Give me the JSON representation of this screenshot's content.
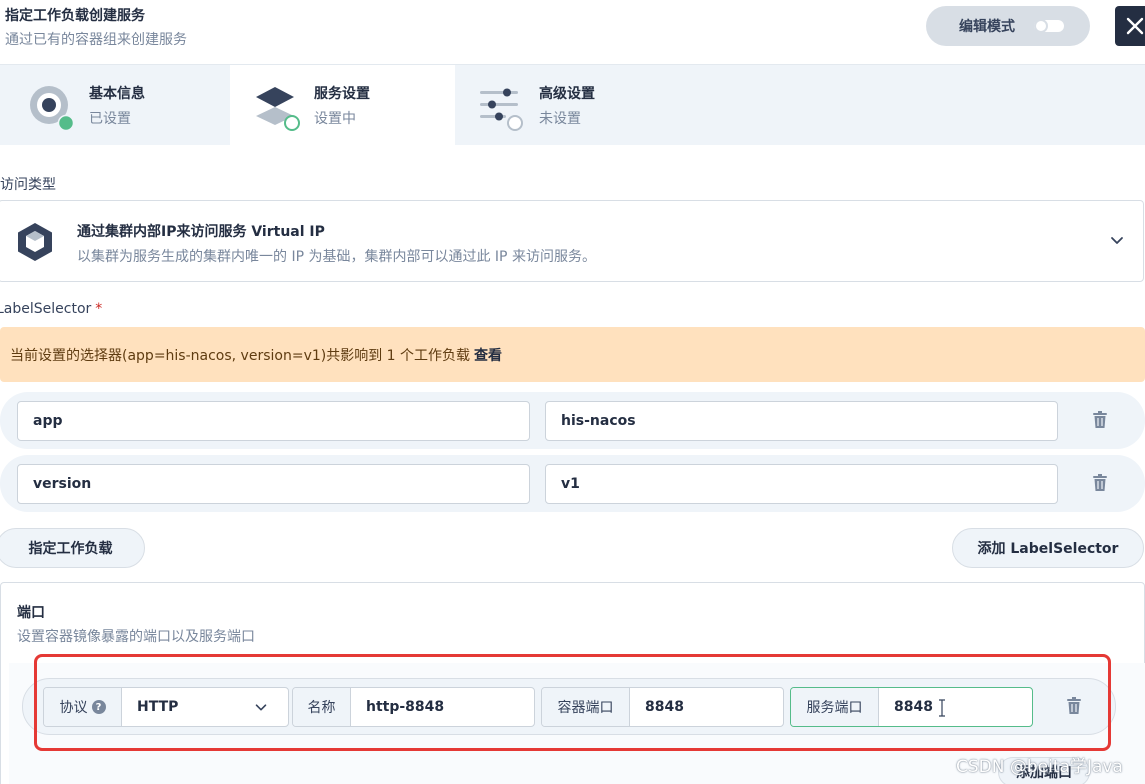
{
  "header": {
    "title": "指定工作负载创建服务",
    "subtitle": "通过已有的容器组来创建服务",
    "edit_mode_label": "编辑模式",
    "close_icon": "close-icon"
  },
  "steps": [
    {
      "label": "基本信息",
      "status": "已设置",
      "icon": "basic-info-icon",
      "state": "done"
    },
    {
      "label": "服务设置",
      "status": "设置中",
      "icon": "service-settings-icon",
      "state": "active"
    },
    {
      "label": "高级设置",
      "status": "未设置",
      "icon": "advanced-settings-icon",
      "state": "pending"
    }
  ],
  "access_type": {
    "section_label": "访问类型",
    "title": "通过集群内部IP来访问服务 Virtual IP",
    "description": "以集群为服务生成的集群内唯一的 IP 为基础，集群内部可以通过此 IP 来访问服务。"
  },
  "label_selector": {
    "section_label": "LabelSelector",
    "required_mark": "*",
    "warning_text": "当前设置的选择器(app=his-nacos, version=v1)共影响到 1 个工作负载",
    "warning_link": "查看",
    "rows": [
      {
        "key": "app",
        "value": "his-nacos"
      },
      {
        "key": "version",
        "value": "v1"
      }
    ],
    "specify_workload_button": "指定工作负载",
    "add_selector_button": "添加 LabelSelector"
  },
  "ports": {
    "title": "端口",
    "description": "设置容器镜像暴露的端口以及服务端口",
    "protocol_label": "协议",
    "help_glyph": "?",
    "protocol_value": "HTTP",
    "name_label": "名称",
    "name_value": "http-8848",
    "container_port_label": "容器端口",
    "container_port_value": "8848",
    "service_port_label": "服务端口",
    "service_port_value": "8848",
    "add_port_button": "添加端口"
  },
  "watermark": "CSDN @beita学Java",
  "colors": {
    "success": "#55bc8a",
    "dark": "#242e42",
    "warning_bg": "#ffe1be",
    "highlight": "#e53935"
  }
}
